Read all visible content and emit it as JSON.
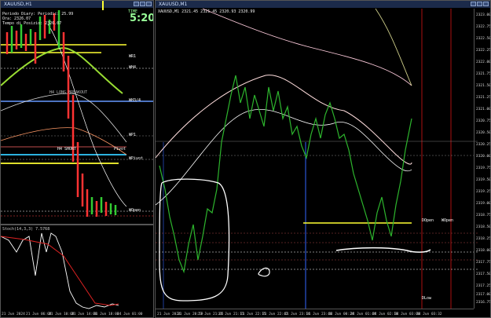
{
  "left_window": {
    "title": "XAUUSD,H1",
    "info_lines": [
      "Periodo Diary: Periodic: 25.99",
      "Ora: 2326.07",
      "Tempo di Posizio: 2326.07"
    ],
    "big_value": "5:20",
    "big_label": "TIME",
    "levels": [
      "WR1",
      "WH4",
      "H4 LONG BREAKOUT",
      "WH3/4",
      "WP1",
      "H4 SHORT",
      "Pivot",
      "WPivot",
      "WOpen"
    ],
    "oscillator_label": "Stoch(14,3,3) 7.5768",
    "time_labels": [
      "21 Jun 2024",
      "21 Jun 06:00",
      "21 Jun 10:00",
      "21 Jun 14:00",
      "21 Jun 18:00",
      "24 Jun 01:00"
    ]
  },
  "right_window": {
    "title": "XAUUSD,M1",
    "info_line": "XAUUSD,M1  2321.45 2321.45 2320.93 2320.99",
    "level_labels": [
      "DOpen",
      "WOpen",
      "DLow"
    ],
    "price_labels": [
      "2323.00",
      "2322.75",
      "2322.50",
      "2322.25",
      "2322.00",
      "2321.75",
      "2321.50",
      "2321.25",
      "2321.00",
      "2320.75",
      "2320.50",
      "2320.25",
      "2320.00",
      "2319.75",
      "2319.50",
      "2319.25",
      "2319.00",
      "2318.75",
      "2318.50",
      "2318.25",
      "2318.00",
      "2317.75",
      "2317.50",
      "2317.25",
      "2317.00",
      "2316.75"
    ],
    "time_labels": [
      "21 Jun 2024",
      "21 Jun 20:59",
      "21 Jun 21:05",
      "21 Jun 21:11",
      "21 Jun 22:15",
      "21 Jun 22:42",
      "21 Jun 23:14",
      "21 Jun 23:46",
      "24 Jun 00:24",
      "24 Jun 01:44",
      "24 Jun 02:18",
      "24 Jun 03:00",
      "24 Jun 03:32"
    ]
  }
}
